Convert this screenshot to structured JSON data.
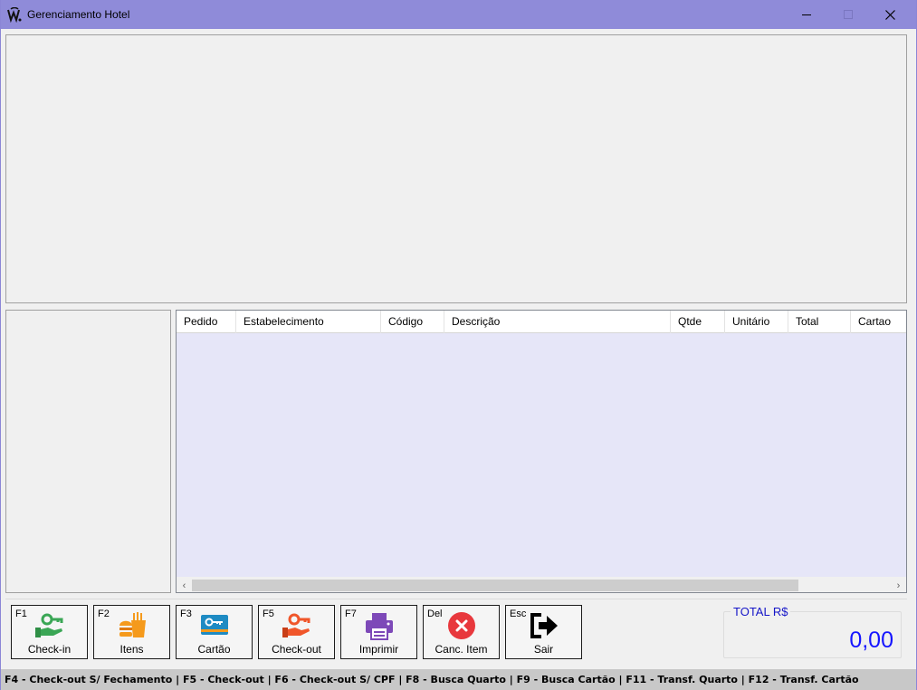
{
  "window": {
    "title": "Gerenciamento Hotel",
    "icons": {
      "app": "hotel-logo-icon",
      "minimize": "minimize-icon",
      "maximize": "maximize-icon",
      "close": "close-icon"
    }
  },
  "grid": {
    "columns": [
      "Pedido",
      "Estabelecimento",
      "Código",
      "Descrição",
      "Qtde",
      "Unitário",
      "Total",
      "Cartao"
    ],
    "rows": [],
    "row_background": "#e6e6f8"
  },
  "function_buttons": [
    {
      "key": "F1",
      "label": "Check-in",
      "icon": "hand-key-icon",
      "color": "#3aa655"
    },
    {
      "key": "F2",
      "label": "Itens",
      "icon": "fast-food-icon",
      "color": "#f59a1c"
    },
    {
      "key": "F3",
      "label": "Cartão",
      "icon": "key-card-icon",
      "color": "#1e8bc3"
    },
    {
      "key": "F5",
      "label": "Check-out",
      "icon": "hand-key-icon",
      "color": "#f0562a"
    },
    {
      "key": "F7",
      "label": "Imprimir",
      "icon": "printer-icon",
      "color": "#7d49b8"
    },
    {
      "key": "Del",
      "label": "Canc. Item",
      "icon": "cancel-circle-icon",
      "color": "#e8383d"
    },
    {
      "key": "Esc",
      "label": "Sair",
      "icon": "exit-icon",
      "color": "#000000"
    }
  ],
  "total": {
    "label": "TOTAL R$",
    "value": "0,00",
    "color": "#1515ff"
  },
  "statusbar": {
    "text": "F4 - Check-out S/ Fechamento  |  F5 - Check-out  |  F6 - Check-out S/ CPF  |  F8 - Busca Quarto  |  F9 - Busca Cartão  |  F11 - Transf. Quarto  |  F12  - Transf. Cartão"
  },
  "colors": {
    "titlebar": "#8f8bd9",
    "background": "#f0f0f0",
    "statusbar": "#c8c8c8"
  }
}
